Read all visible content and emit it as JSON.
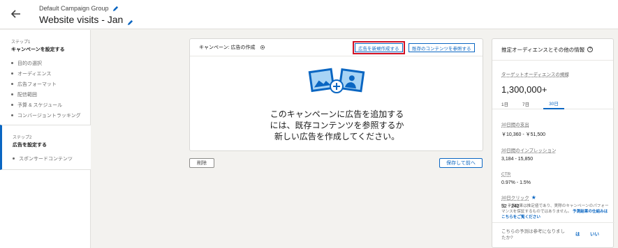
{
  "header": {
    "group_name": "Default Campaign Group",
    "campaign_title": "Website visits - Jan"
  },
  "sidebar": {
    "step1": {
      "num": "ステップ1",
      "title": "キャンペーンを設定する",
      "items": [
        "目的の選択",
        "オーディエンス",
        "広告フォーマット",
        "配信範囲",
        "予算 & スケジュール",
        "コンバージョントラッキング"
      ]
    },
    "step2": {
      "num": "ステップ2",
      "title": "広告を設定する",
      "items": [
        "スポンサードコンテンツ"
      ]
    }
  },
  "main": {
    "card_title": "キャンペーン: 広告の作成",
    "new_ad_button": "広告を新規作成する",
    "browse_button": "既存のコンテンツを参照する",
    "empty_line1": "このキャンペーンに広告を追加する",
    "empty_line2": "には、既存コンテンツを参照するか",
    "empty_line3": "新しい広告を作成してください。",
    "delete_button": "削除",
    "save_button": "保存して前へ"
  },
  "right_panel": {
    "title": "推定オーディエンスとその他の情報",
    "audience_label": "ターゲットオーディエンスの規模",
    "audience_size": "1,300,000+",
    "tabs": [
      "1日",
      "7日",
      "30日"
    ],
    "active_tab": "30日",
    "metrics": [
      {
        "label": "30日間の支出",
        "value": "￥10,360 - ￥51,500"
      },
      {
        "label": "30日間のインプレッション",
        "value": "3,184 - 15,850"
      },
      {
        "label": "CTR",
        "value": "0.97% - 1.5%"
      },
      {
        "label": "30日クリック",
        "value": "52 - 242"
      }
    ],
    "note_text": "注: 予測結果は推定値であり、実際のキャンペーンのパフォーマンスを保証するものではありません。",
    "note_link": "予測結果の仕組みはこちらをご覧ください",
    "feedback_question": "こちらの予測は参考になりましたか?",
    "feedback_yes": "は",
    "feedback_no": "いい"
  },
  "colors": {
    "accent": "#0a66c2",
    "highlight": "#d11124",
    "background": "#f3f2ef"
  }
}
